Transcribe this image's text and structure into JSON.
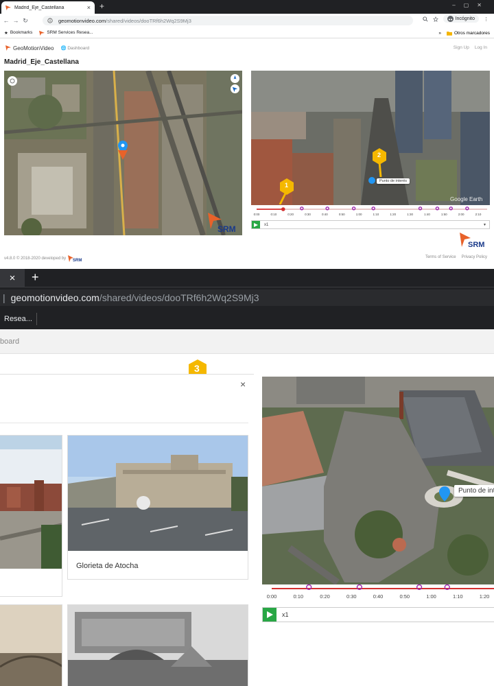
{
  "browser": {
    "tab_title": "Madrid_Eje_Castellana",
    "tab_close": "×",
    "new_tab": "+",
    "url_host": "geomotionvideo.com",
    "url_path": "/shared/videos/dooTRf6h2Wq2S9Mj3",
    "incognito_label": "Incógnito",
    "bookmarks_label": "Bookmarks",
    "bookmark_item": "SRM Services Resea...",
    "other_bookmarks": "Otros marcadores",
    "more": "»"
  },
  "app": {
    "brand": "GeoMotionVideo",
    "dashboard": "Dashboard",
    "sign_up": "Sign Up",
    "log_in": "Log In",
    "page_title": "Madrid_Eje_Castellana",
    "google_earth": "Google Earth",
    "poi_label": "Punto de interés",
    "speed": "x1",
    "timeline_ticks": [
      "0:00",
      "0:10",
      "0:20",
      "0:30",
      "0:40",
      "0:50",
      "1:00",
      "1:10",
      "1:20",
      "1:30",
      "1:40",
      "1:50",
      "2:00",
      "2:10"
    ],
    "progress_fraction": 0.12,
    "footer_left": "v4.8.0 © 2018-2020 developed by",
    "terms": "Terms of Service",
    "privacy": "Privacy Policy",
    "marker_1": "1",
    "marker_2": "2",
    "srm": "SRM"
  },
  "zoom": {
    "tab_close": "×",
    "new_tab": "+",
    "url_host": "geomotionvideo.com",
    "url_path": "/shared/videos/dooTRf6h2Wq2S9Mj3",
    "bookmark_item": "Resea...",
    "dashboard_partial": "board",
    "marker_3": "3",
    "modal_close": "×",
    "card_title": "Glorieta de Atocha",
    "poi_label": "Punto de inte",
    "speed": "x1",
    "timeline_ticks": [
      "0:00",
      "0:10",
      "0:20",
      "0:30",
      "0:40",
      "0:50",
      "1:00",
      "1:10",
      "1:20"
    ]
  },
  "colors": {
    "accent": "#28a745",
    "timeline": "#d32f2f",
    "marker": "#f5b800",
    "poi": "#2196f3",
    "waypoint": "#9c27b0"
  }
}
